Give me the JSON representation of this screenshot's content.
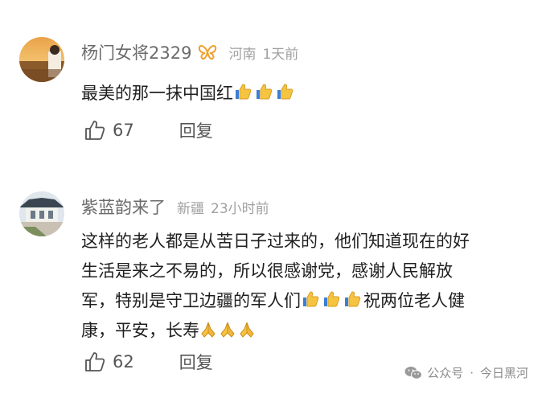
{
  "comments": [
    {
      "username": "杨门女将2329",
      "location": "河南",
      "time": "1天前",
      "content": "最美的那一抹中国红",
      "emojis": [
        "thumbs-up-icon",
        "thumbs-up-icon",
        "thumbs-up-icon"
      ],
      "likes": "67",
      "reply_label": "回复"
    },
    {
      "username": "紫蓝韵来了",
      "location": "新疆",
      "time": "23小时前",
      "content_lines": [
        "这样的老人都是从苦日子过来的，他们知道现在的好",
        "生活是来之不易的，所以很感谢党，感谢人民解放",
        "军，特别是守卫边疆的军人们",
        "祝两位老人健",
        "康，平安，长寿"
      ],
      "emojis_line3": [
        "thumbs-up-icon",
        "thumbs-up-icon",
        "thumbs-up-icon"
      ],
      "emojis_line4": [
        "praying-hands-icon",
        "praying-hands-icon",
        "praying-hands-icon"
      ],
      "likes": "62",
      "reply_label": "回复"
    }
  ],
  "watermark": {
    "account_type": "公众号",
    "separator": "·",
    "account_name": "今日黑河"
  },
  "colors": {
    "username": "#6b6b6b",
    "meta": "#a0a0a0",
    "badge": "#f0a030",
    "thumb_emoji": "#f5c542"
  }
}
